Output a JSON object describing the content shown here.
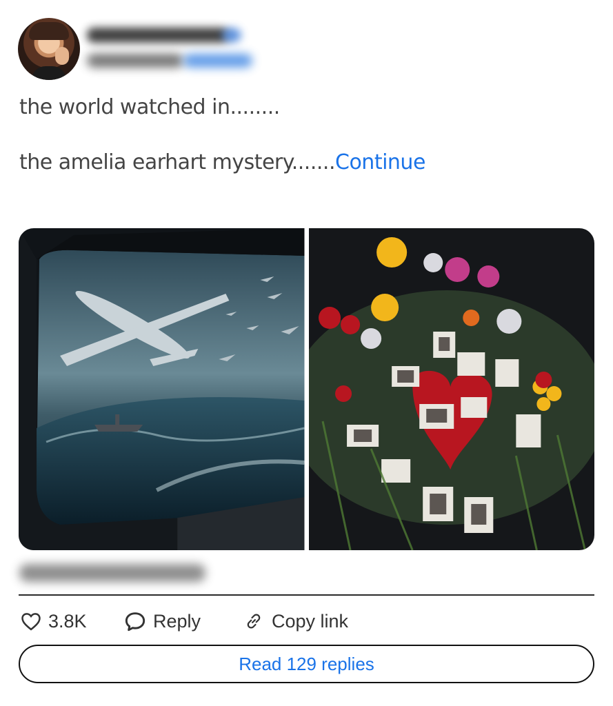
{
  "post": {
    "text_line1": "the world watched in........",
    "text_line2": "the amelia earhart mystery.......",
    "continue_link": "Continue"
  },
  "media": {
    "left_image": "airplanes-over-stormy-sea",
    "right_image": "memorial-flowers-and-photos"
  },
  "actions": {
    "like_count": "3.8K",
    "reply_label": "Reply",
    "copy_link_label": "Copy link"
  },
  "read_replies": "Read 129 replies",
  "colors": {
    "link": "#1a73e8",
    "text": "#444444"
  },
  "icons": {
    "like": "heart-icon",
    "reply": "speech-bubble-icon",
    "copy": "link-icon"
  }
}
